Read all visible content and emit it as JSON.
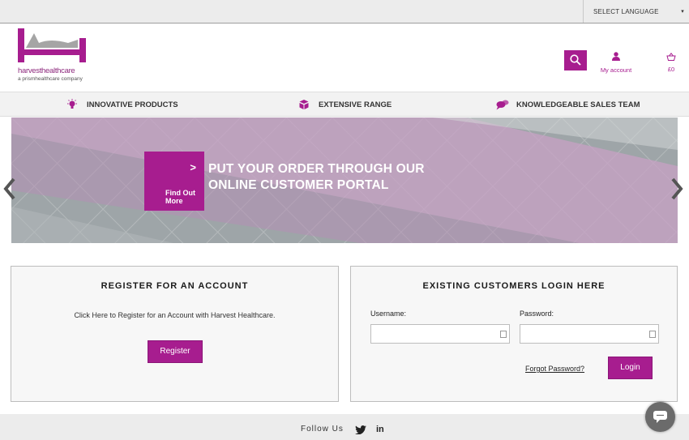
{
  "topbar": {
    "language_label": "SELECT LANGUAGE",
    "language_caret": "▾"
  },
  "header": {
    "logo_text": "harvesthealthcare",
    "logo_subtext": "a prismhealthcare company",
    "account_label": "My account",
    "cart_total": "£0"
  },
  "features": [
    {
      "label": "INNOVATIVE PRODUCTS",
      "icon": "lightbulb-icon"
    },
    {
      "label": "EXTENSIVE RANGE",
      "icon": "boxes-icon"
    },
    {
      "label": "KNOWLEDGEABLE SALES TEAM",
      "icon": "speech-bubble-icon"
    }
  ],
  "hero": {
    "cta_label": "Find Out More",
    "cta_chevron": ">",
    "title_line1": "PUT YOUR ORDER THROUGH OUR",
    "title_line2": "ONLINE CUSTOMER PORTAL"
  },
  "register": {
    "heading": "REGISTER FOR AN ACCOUNT",
    "text": "Click Here to Register for an Account with Harvest Healthcare.",
    "button": "Register"
  },
  "login": {
    "heading": "EXISTING CUSTOMERS LOGIN HERE",
    "username_label": "Username:",
    "password_label": "Password:",
    "username_value": "",
    "password_value": "",
    "forgot": "Forgot Password?",
    "button": "Login"
  },
  "footer": {
    "follow": "Follow Us",
    "linkedin": "in"
  },
  "colors": {
    "brand": "#a71d8f",
    "panel_bg": "#f7f7f7",
    "bar_bg": "#ececec"
  }
}
